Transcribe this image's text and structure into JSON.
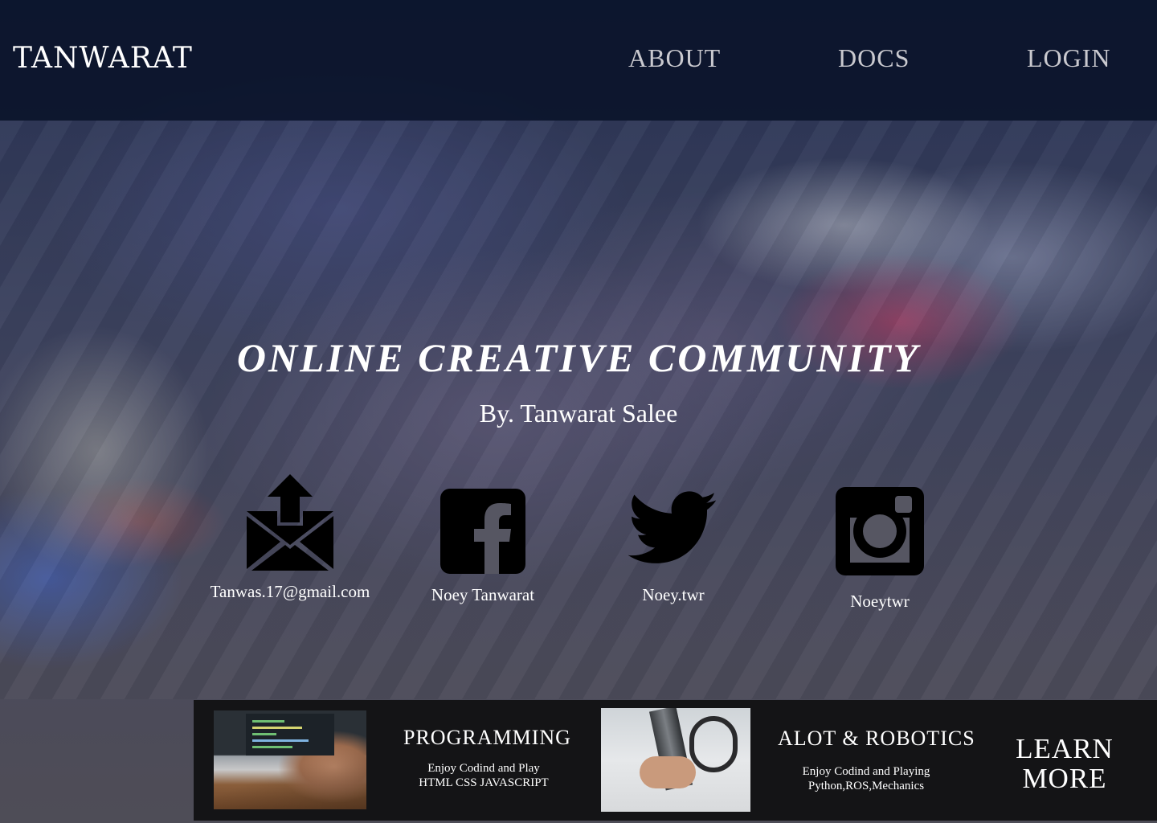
{
  "header": {
    "brand": "TANWARAT",
    "nav": {
      "about": "ABOUT",
      "docs": "DOCS",
      "login": "LOGIN"
    }
  },
  "hero": {
    "title": "ONLINE CREATIVE COMMUNITY",
    "subtitle": "By. Tanwarat Salee"
  },
  "contacts": {
    "email": {
      "label": "Tanwas.17@gmail.com",
      "icon": "email-send-icon"
    },
    "facebook": {
      "label": "Noey Tanwarat",
      "icon": "facebook-icon"
    },
    "twitter": {
      "label": "Noey.twr",
      "icon": "twitter-icon"
    },
    "instagram": {
      "label": "Noeytwr",
      "icon": "instagram-icon"
    }
  },
  "cards": {
    "programming": {
      "title": "PROGRAMMING",
      "desc_line1": "Enjoy Codind and Play",
      "desc_line2": "HTML CSS JAVASCRIPT"
    },
    "robotics": {
      "title": "ALOT & ROBOTICS",
      "desc_line1": "Enjoy Codind and Playing",
      "desc_line2": "Python,ROS,Mechanics"
    },
    "learn_more_line1": "LEARN",
    "learn_more_line2": "MORE"
  },
  "colors": {
    "header_bg": "#08122a",
    "bottom_bar_bg": "#141416",
    "text": "#ffffff",
    "nav_text": "#c9c9cf",
    "icon": "#000000"
  }
}
